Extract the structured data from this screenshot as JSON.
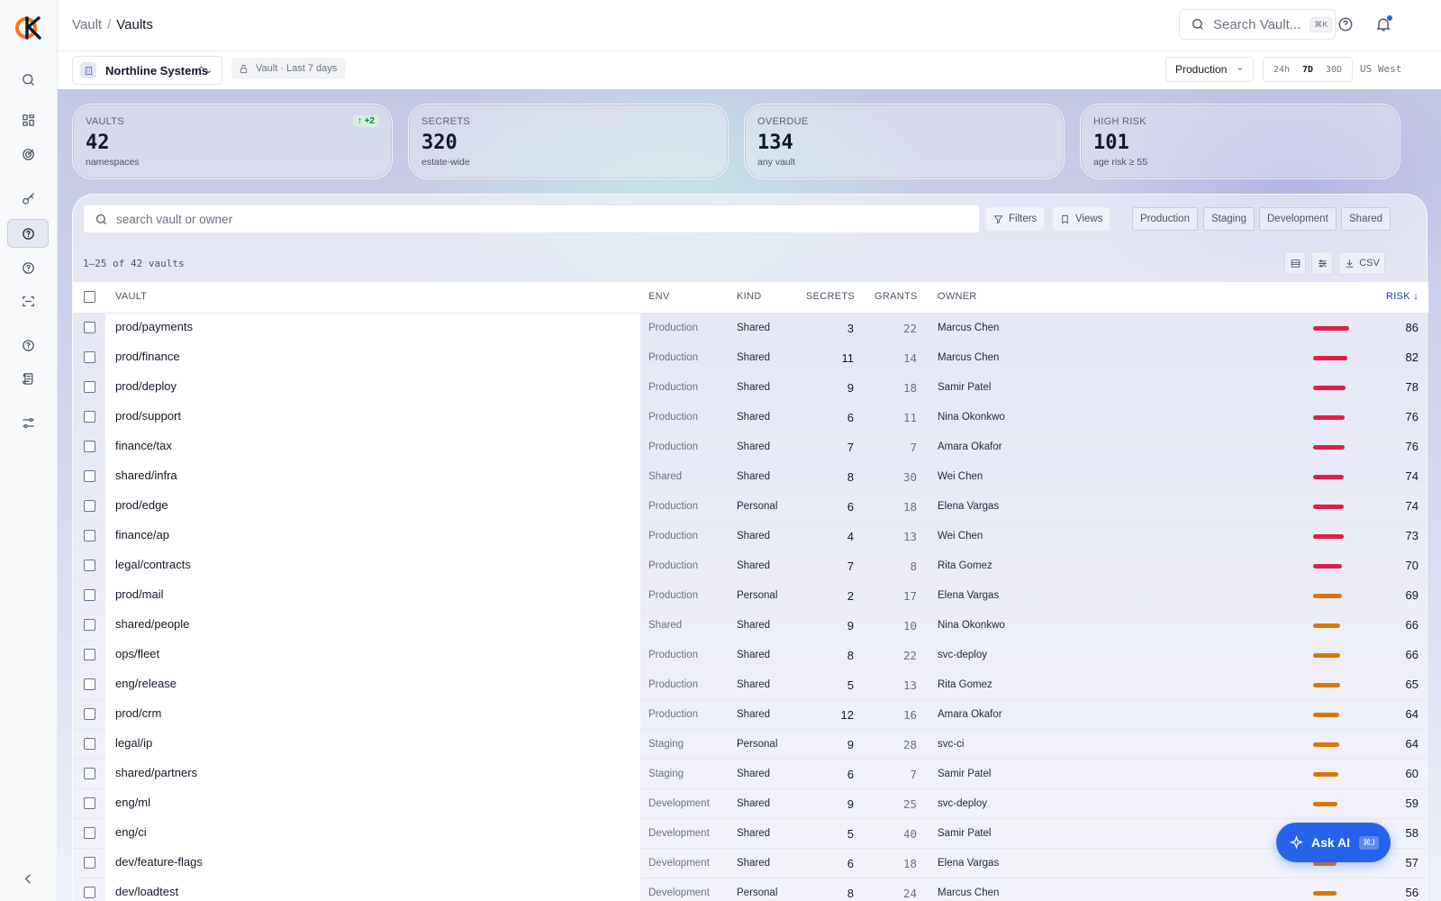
{
  "breadcrumb": {
    "root": "Vault",
    "sep": "/",
    "current": "Vaults"
  },
  "search": {
    "placeholder": "Search Vault...",
    "shortcut": "⌘K"
  },
  "org": {
    "name": "Northline Systems"
  },
  "scope": "Vault · Last 7 days",
  "env_select": "Production",
  "ranges": [
    "24h",
    "7D",
    "30D"
  ],
  "active_range": "7D",
  "region": "US West",
  "stats": [
    {
      "label": "VAULTS",
      "value": "42",
      "sub": "namespaces",
      "delta": "↑ +2"
    },
    {
      "label": "SECRETS",
      "value": "320",
      "sub": "estate-wide"
    },
    {
      "label": "OVERDUE",
      "value": "134",
      "sub": "any vault"
    },
    {
      "label": "HIGH RISK",
      "value": "101",
      "sub": "age risk ≥ 55"
    }
  ],
  "toolbar": {
    "search_placeholder": "search vault or owner",
    "filters": "Filters",
    "views": "Views",
    "chips": [
      "Production",
      "Staging",
      "Development",
      "Shared"
    ],
    "count": "1–25 of 42 vaults",
    "csv": "CSV"
  },
  "columns": {
    "vault": "VAULT",
    "env": "ENV",
    "kind": "KIND",
    "secrets": "SECRETS",
    "grants": "GRANTS",
    "owner": "OWNER",
    "risk": "RISK ↓"
  },
  "colors": {
    "risk_high": "#e11d48",
    "risk_med": "#d97706",
    "accent": "#2563eb"
  },
  "rows": [
    {
      "vault": "prod/payments",
      "env": "Production",
      "kind": "Shared",
      "secrets": "3",
      "grants": "22",
      "owner": "Marcus Chen",
      "risk": "86"
    },
    {
      "vault": "prod/finance",
      "env": "Production",
      "kind": "Shared",
      "secrets": "11",
      "grants": "14",
      "owner": "Marcus Chen",
      "risk": "82"
    },
    {
      "vault": "prod/deploy",
      "env": "Production",
      "kind": "Shared",
      "secrets": "9",
      "grants": "18",
      "owner": "Samir Patel",
      "risk": "78"
    },
    {
      "vault": "prod/support",
      "env": "Production",
      "kind": "Shared",
      "secrets": "6",
      "grants": "11",
      "owner": "Nina Okonkwo",
      "risk": "76"
    },
    {
      "vault": "finance/tax",
      "env": "Production",
      "kind": "Shared",
      "secrets": "7",
      "grants": "7",
      "owner": "Amara Okafor",
      "risk": "76"
    },
    {
      "vault": "shared/infra",
      "env": "Shared",
      "kind": "Shared",
      "secrets": "8",
      "grants": "30",
      "owner": "Wei Chen",
      "risk": "74"
    },
    {
      "vault": "prod/edge",
      "env": "Production",
      "kind": "Personal",
      "secrets": "6",
      "grants": "18",
      "owner": "Elena Vargas",
      "risk": "74"
    },
    {
      "vault": "finance/ap",
      "env": "Production",
      "kind": "Shared",
      "secrets": "4",
      "grants": "13",
      "owner": "Wei Chen",
      "risk": "73"
    },
    {
      "vault": "legal/contracts",
      "env": "Production",
      "kind": "Shared",
      "secrets": "7",
      "grants": "8",
      "owner": "Rita Gomez",
      "risk": "70"
    },
    {
      "vault": "prod/mail",
      "env": "Production",
      "kind": "Personal",
      "secrets": "2",
      "grants": "17",
      "owner": "Elena Vargas",
      "risk": "69"
    },
    {
      "vault": "shared/people",
      "env": "Shared",
      "kind": "Shared",
      "secrets": "9",
      "grants": "10",
      "owner": "Nina Okonkwo",
      "risk": "66"
    },
    {
      "vault": "ops/fleet",
      "env": "Production",
      "kind": "Shared",
      "secrets": "8",
      "grants": "22",
      "owner": "svc-deploy",
      "risk": "66"
    },
    {
      "vault": "eng/release",
      "env": "Production",
      "kind": "Shared",
      "secrets": "5",
      "grants": "13",
      "owner": "Rita Gomez",
      "risk": "65"
    },
    {
      "vault": "prod/crm",
      "env": "Production",
      "kind": "Shared",
      "secrets": "12",
      "grants": "16",
      "owner": "Amara Okafor",
      "risk": "64"
    },
    {
      "vault": "legal/ip",
      "env": "Staging",
      "kind": "Personal",
      "secrets": "9",
      "grants": "28",
      "owner": "svc-ci",
      "risk": "64"
    },
    {
      "vault": "shared/partners",
      "env": "Staging",
      "kind": "Shared",
      "secrets": "6",
      "grants": "7",
      "owner": "Samir Patel",
      "risk": "60"
    },
    {
      "vault": "eng/ml",
      "env": "Development",
      "kind": "Shared",
      "secrets": "9",
      "grants": "25",
      "owner": "svc-deploy",
      "risk": "59"
    },
    {
      "vault": "eng/ci",
      "env": "Development",
      "kind": "Shared",
      "secrets": "5",
      "grants": "40",
      "owner": "Samir Patel",
      "risk": "58"
    },
    {
      "vault": "dev/feature-flags",
      "env": "Development",
      "kind": "Shared",
      "secrets": "6",
      "grants": "18",
      "owner": "Elena Vargas",
      "risk": "57"
    },
    {
      "vault": "dev/loadtest",
      "env": "Development",
      "kind": "Personal",
      "secrets": "8",
      "grants": "24",
      "owner": "Marcus Chen",
      "risk": "56"
    }
  ],
  "ask_ai": {
    "label": "Ask AI",
    "shortcut": "⌘J"
  }
}
